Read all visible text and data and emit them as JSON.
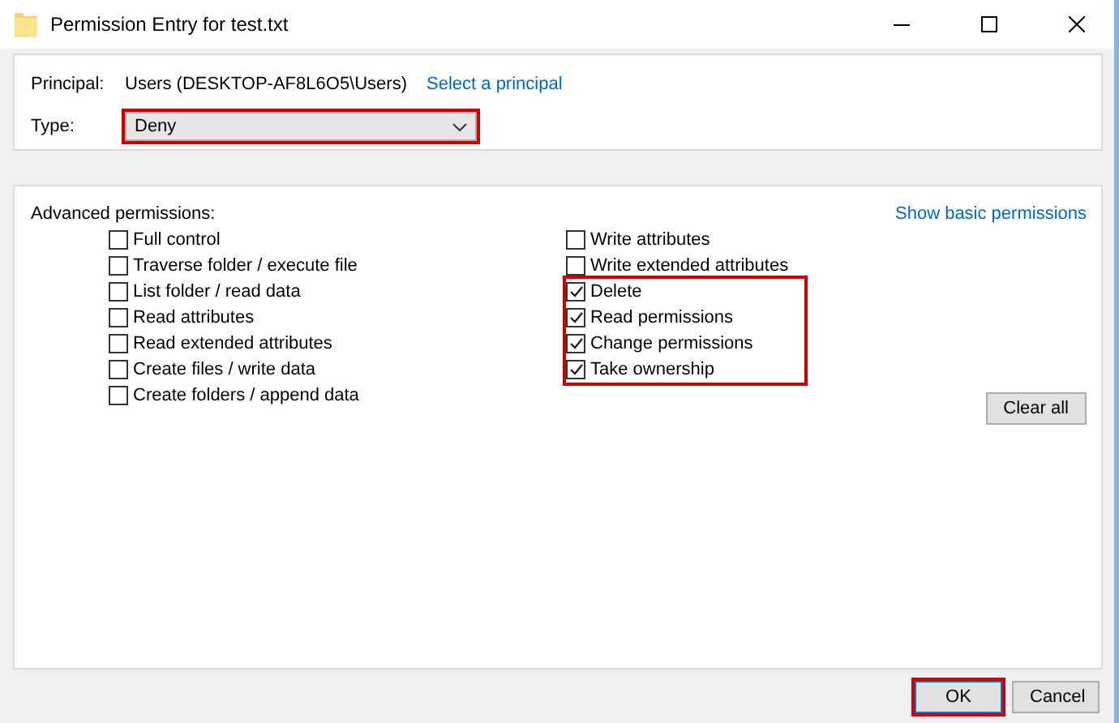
{
  "window": {
    "title": "Permission Entry for test.txt"
  },
  "principal": {
    "label": "Principal:",
    "value": "Users (DESKTOP-AF8L6O5\\Users)",
    "link": "Select a principal"
  },
  "type": {
    "label": "Type:",
    "value": "Deny",
    "highlighted": true
  },
  "advanced": {
    "label": "Advanced permissions:",
    "link": "Show basic permissions",
    "columns": [
      {
        "groups": [
          {
            "highlighted": false,
            "items": [
              {
                "label": "Full control",
                "checked": false
              },
              {
                "label": "Traverse folder / execute file",
                "checked": false
              },
              {
                "label": "List folder / read data",
                "checked": false
              },
              {
                "label": "Read attributes",
                "checked": false
              },
              {
                "label": "Read extended attributes",
                "checked": false
              },
              {
                "label": "Create files / write data",
                "checked": false
              },
              {
                "label": "Create folders / append data",
                "checked": false
              }
            ]
          }
        ]
      },
      {
        "groups": [
          {
            "highlighted": false,
            "items": [
              {
                "label": "Write attributes",
                "checked": false
              },
              {
                "label": "Write extended attributes",
                "checked": false
              }
            ]
          },
          {
            "highlighted": true,
            "items": [
              {
                "label": "Delete",
                "checked": true
              },
              {
                "label": "Read permissions",
                "checked": true
              },
              {
                "label": "Change permissions",
                "checked": true
              },
              {
                "label": "Take ownership",
                "checked": true
              }
            ]
          }
        ]
      }
    ],
    "clear_button": "Clear all"
  },
  "buttons": [
    {
      "label": "OK",
      "highlighted": true
    },
    {
      "label": "Cancel",
      "highlighted": false
    }
  ]
}
